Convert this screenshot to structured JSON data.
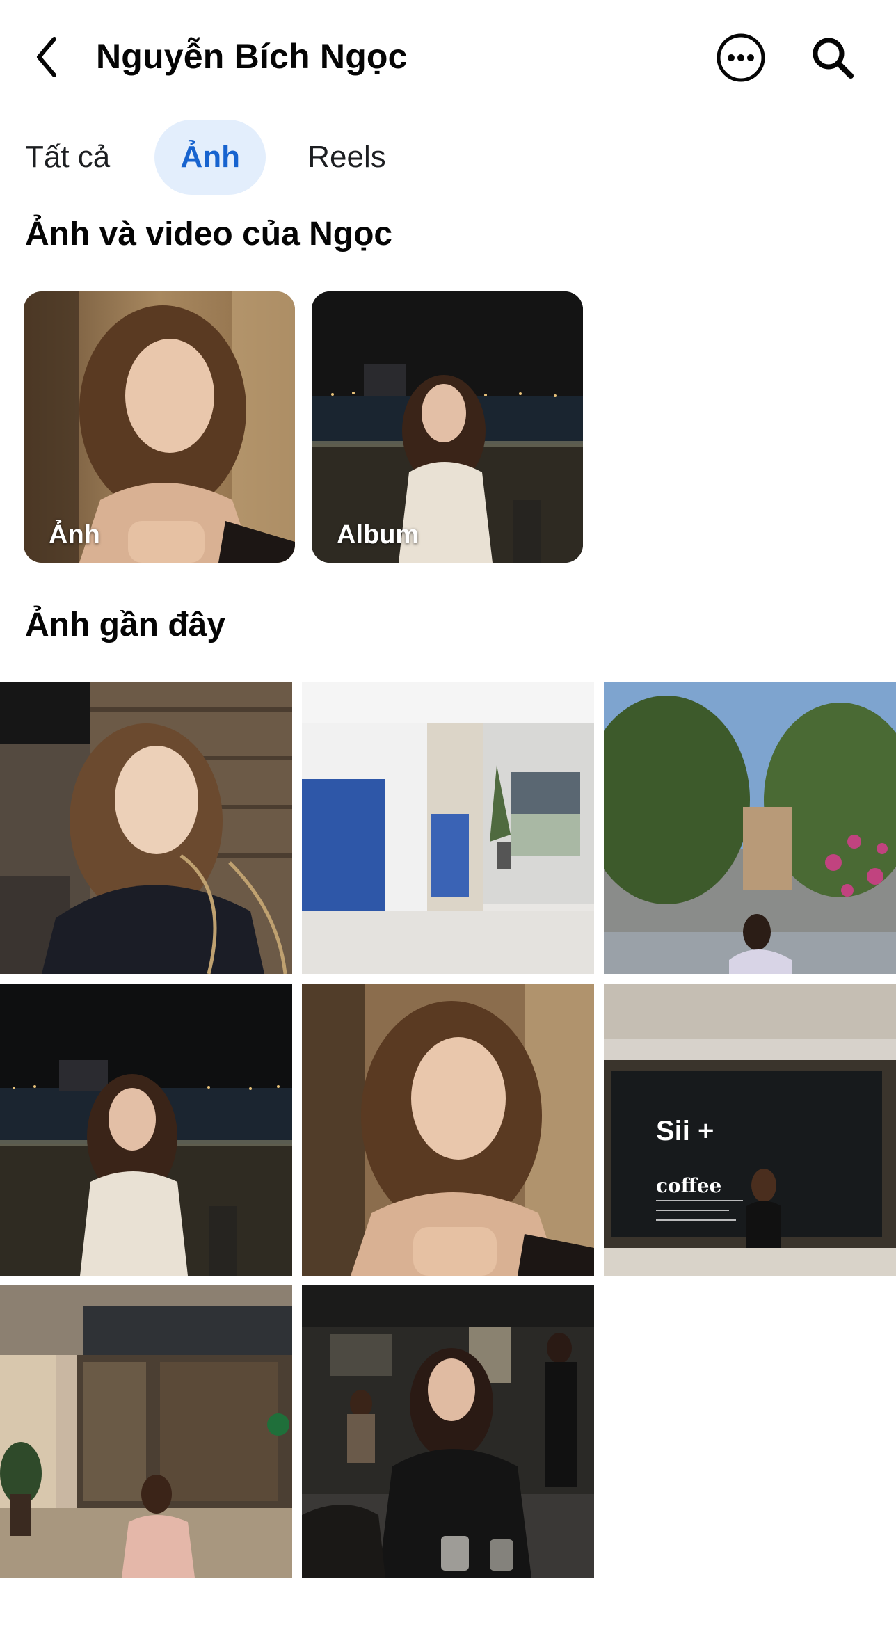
{
  "header": {
    "title": "Nguyễn Bích Ngọc",
    "back_icon": "chevron-left-icon",
    "more_icon": "more-horizontal-circle-icon",
    "search_icon": "search-icon"
  },
  "tabs": [
    {
      "label": "Tất cả",
      "active": false
    },
    {
      "label": "Ảnh",
      "active": true
    },
    {
      "label": "Reels",
      "active": false
    }
  ],
  "albums_section": {
    "title": "Ảnh và video của Ngọc",
    "cards": [
      {
        "label": "Ảnh"
      },
      {
        "label": "Album"
      }
    ]
  },
  "recent_section": {
    "title": "Ảnh gần đây",
    "photos": [
      {
        "desc": "portrait-dark-sweater"
      },
      {
        "desc": "modern-interior"
      },
      {
        "desc": "park-with-trees"
      },
      {
        "desc": "night-river-terrace"
      },
      {
        "desc": "portrait-wood-wall"
      },
      {
        "desc": "cafe-window-sign",
        "sign_text": "Sii +",
        "sign_word": "coffee"
      },
      {
        "desc": "mall-storefront"
      },
      {
        "desc": "restaurant-black-dress"
      }
    ]
  },
  "colors": {
    "accent": "#1763cf",
    "tab_active_bg": "#e3eefc",
    "text": "#050505"
  }
}
